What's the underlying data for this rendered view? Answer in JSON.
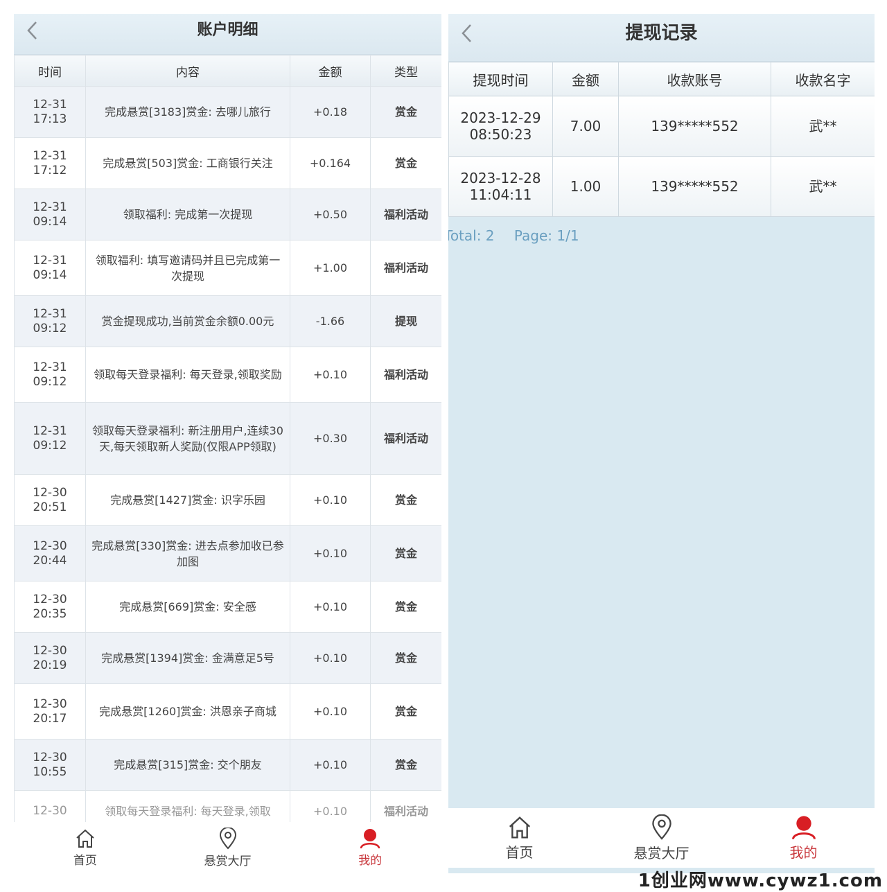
{
  "left": {
    "title": "账户明细",
    "columns": [
      "时间",
      "内容",
      "金额",
      "类型"
    ],
    "rows": [
      {
        "date": "12-31",
        "time": "17:13",
        "content": "完成悬赏[3183]赏金: 去哪儿旅行",
        "amount": "+0.18",
        "type": "赏金"
      },
      {
        "date": "12-31",
        "time": "17:12",
        "content": "完成悬赏[503]赏金: 工商银行关注",
        "amount": "+0.164",
        "type": "赏金"
      },
      {
        "date": "12-31",
        "time": "09:14",
        "content": "领取福利: 完成第一次提现",
        "amount": "+0.50",
        "type": "福利活动"
      },
      {
        "date": "12-31",
        "time": "09:14",
        "content": "领取福利: 填写邀请码并且已完成第一次提现",
        "amount": "+1.00",
        "type": "福利活动"
      },
      {
        "date": "12-31",
        "time": "09:12",
        "content": "赏金提现成功,当前赏金余额0.00元",
        "amount": "-1.66",
        "type": "提现"
      },
      {
        "date": "12-31",
        "time": "09:12",
        "content": "领取每天登录福利: 每天登录,领取奖励",
        "amount": "+0.10",
        "type": "福利活动"
      },
      {
        "date": "12-31",
        "time": "09:12",
        "content": "领取每天登录福利: 新注册用户,连续30天,每天领取新人奖励(仅限APP领取)",
        "amount": "+0.30",
        "type": "福利活动"
      },
      {
        "date": "12-30",
        "time": "20:51",
        "content": "完成悬赏[1427]赏金: 识字乐园",
        "amount": "+0.10",
        "type": "赏金"
      },
      {
        "date": "12-30",
        "time": "20:44",
        "content": "完成悬赏[330]赏金: 进去点参加收已参加图",
        "amount": "+0.10",
        "type": "赏金"
      },
      {
        "date": "12-30",
        "time": "20:35",
        "content": "完成悬赏[669]赏金: 安全感",
        "amount": "+0.10",
        "type": "赏金"
      },
      {
        "date": "12-30",
        "time": "20:19",
        "content": "完成悬赏[1394]赏金: 金满意足5号",
        "amount": "+0.10",
        "type": "赏金"
      },
      {
        "date": "12-30",
        "time": "20:17",
        "content": "完成悬赏[1260]赏金: 洪恩亲子商城",
        "amount": "+0.10",
        "type": "赏金"
      },
      {
        "date": "12-30",
        "time": "10:55",
        "content": "完成悬赏[315]赏金: 交个朋友",
        "amount": "+0.10",
        "type": "赏金"
      },
      {
        "date": "12-30",
        "time": "",
        "content": "领取每天登录福利: 每天登录,领取",
        "amount": "+0.10",
        "type": "福利活动"
      }
    ],
    "tabs": [
      {
        "label": "首页",
        "icon": "home-icon"
      },
      {
        "label": "悬赏大厅",
        "icon": "location-pin-icon"
      },
      {
        "label": "我的",
        "icon": "user-icon",
        "active": true
      }
    ]
  },
  "right": {
    "title": "提现记录",
    "columns": [
      "提现时间",
      "金额",
      "收款账号",
      "收款名字"
    ],
    "rows": [
      {
        "date": "2023-12-29",
        "time": "08:50:23",
        "amount": "7.00",
        "account": "139*****552",
        "name": "武**"
      },
      {
        "date": "2023-12-28",
        "time": "11:04:11",
        "amount": "1.00",
        "account": "139*****552",
        "name": "武**"
      }
    ],
    "total_text": "Total: 2",
    "page_text": "Page: 1/1",
    "tabs": [
      {
        "label": "首页",
        "icon": "home-icon"
      },
      {
        "label": "悬赏大厅",
        "icon": "location-pin-icon"
      },
      {
        "label": "我的",
        "icon": "user-icon",
        "active": true
      }
    ]
  },
  "watermark": "1创业网www.cywz1.com",
  "colors": {
    "accent_red": "#c8353a",
    "withdraw_green": "#1e8a1e",
    "header_bg": "#dbe8f0",
    "panel_bg": "#d9e9f1"
  }
}
